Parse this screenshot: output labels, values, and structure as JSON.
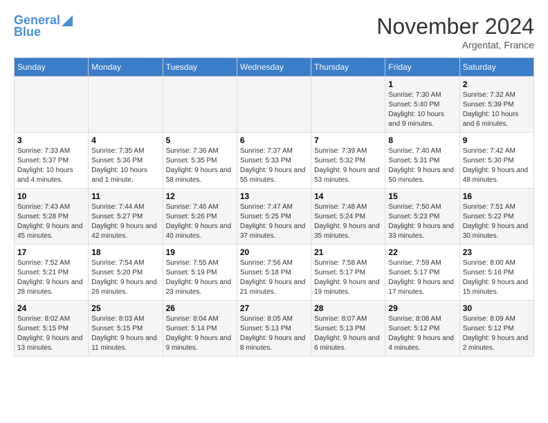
{
  "header": {
    "logo_line1": "General",
    "logo_line2": "Blue",
    "month": "November 2024",
    "location": "Argentat, France"
  },
  "weekdays": [
    "Sunday",
    "Monday",
    "Tuesday",
    "Wednesday",
    "Thursday",
    "Friday",
    "Saturday"
  ],
  "weeks": [
    [
      {
        "day": "",
        "info": ""
      },
      {
        "day": "",
        "info": ""
      },
      {
        "day": "",
        "info": ""
      },
      {
        "day": "",
        "info": ""
      },
      {
        "day": "",
        "info": ""
      },
      {
        "day": "1",
        "info": "Sunrise: 7:30 AM\nSunset: 5:40 PM\nDaylight: 10 hours and 9 minutes."
      },
      {
        "day": "2",
        "info": "Sunrise: 7:32 AM\nSunset: 5:39 PM\nDaylight: 10 hours and 6 minutes."
      }
    ],
    [
      {
        "day": "3",
        "info": "Sunrise: 7:33 AM\nSunset: 5:37 PM\nDaylight: 10 hours and 4 minutes."
      },
      {
        "day": "4",
        "info": "Sunrise: 7:35 AM\nSunset: 5:36 PM\nDaylight: 10 hours and 1 minute."
      },
      {
        "day": "5",
        "info": "Sunrise: 7:36 AM\nSunset: 5:35 PM\nDaylight: 9 hours and 58 minutes."
      },
      {
        "day": "6",
        "info": "Sunrise: 7:37 AM\nSunset: 5:33 PM\nDaylight: 9 hours and 55 minutes."
      },
      {
        "day": "7",
        "info": "Sunrise: 7:39 AM\nSunset: 5:32 PM\nDaylight: 9 hours and 53 minutes."
      },
      {
        "day": "8",
        "info": "Sunrise: 7:40 AM\nSunset: 5:31 PM\nDaylight: 9 hours and 50 minutes."
      },
      {
        "day": "9",
        "info": "Sunrise: 7:42 AM\nSunset: 5:30 PM\nDaylight: 9 hours and 48 minutes."
      }
    ],
    [
      {
        "day": "10",
        "info": "Sunrise: 7:43 AM\nSunset: 5:28 PM\nDaylight: 9 hours and 45 minutes."
      },
      {
        "day": "11",
        "info": "Sunrise: 7:44 AM\nSunset: 5:27 PM\nDaylight: 9 hours and 42 minutes."
      },
      {
        "day": "12",
        "info": "Sunrise: 7:46 AM\nSunset: 5:26 PM\nDaylight: 9 hours and 40 minutes."
      },
      {
        "day": "13",
        "info": "Sunrise: 7:47 AM\nSunset: 5:25 PM\nDaylight: 9 hours and 37 minutes."
      },
      {
        "day": "14",
        "info": "Sunrise: 7:48 AM\nSunset: 5:24 PM\nDaylight: 9 hours and 35 minutes."
      },
      {
        "day": "15",
        "info": "Sunrise: 7:50 AM\nSunset: 5:23 PM\nDaylight: 9 hours and 33 minutes."
      },
      {
        "day": "16",
        "info": "Sunrise: 7:51 AM\nSunset: 5:22 PM\nDaylight: 9 hours and 30 minutes."
      }
    ],
    [
      {
        "day": "17",
        "info": "Sunrise: 7:52 AM\nSunset: 5:21 PM\nDaylight: 9 hours and 28 minutes."
      },
      {
        "day": "18",
        "info": "Sunrise: 7:54 AM\nSunset: 5:20 PM\nDaylight: 9 hours and 26 minutes."
      },
      {
        "day": "19",
        "info": "Sunrise: 7:55 AM\nSunset: 5:19 PM\nDaylight: 9 hours and 23 minutes."
      },
      {
        "day": "20",
        "info": "Sunrise: 7:56 AM\nSunset: 5:18 PM\nDaylight: 9 hours and 21 minutes."
      },
      {
        "day": "21",
        "info": "Sunrise: 7:58 AM\nSunset: 5:17 PM\nDaylight: 9 hours and 19 minutes."
      },
      {
        "day": "22",
        "info": "Sunrise: 7:59 AM\nSunset: 5:17 PM\nDaylight: 9 hours and 17 minutes."
      },
      {
        "day": "23",
        "info": "Sunrise: 8:00 AM\nSunset: 5:16 PM\nDaylight: 9 hours and 15 minutes."
      }
    ],
    [
      {
        "day": "24",
        "info": "Sunrise: 8:02 AM\nSunset: 5:15 PM\nDaylight: 9 hours and 13 minutes."
      },
      {
        "day": "25",
        "info": "Sunrise: 8:03 AM\nSunset: 5:15 PM\nDaylight: 9 hours and 11 minutes."
      },
      {
        "day": "26",
        "info": "Sunrise: 8:04 AM\nSunset: 5:14 PM\nDaylight: 9 hours and 9 minutes."
      },
      {
        "day": "27",
        "info": "Sunrise: 8:05 AM\nSunset: 5:13 PM\nDaylight: 9 hours and 8 minutes."
      },
      {
        "day": "28",
        "info": "Sunrise: 8:07 AM\nSunset: 5:13 PM\nDaylight: 9 hours and 6 minutes."
      },
      {
        "day": "29",
        "info": "Sunrise: 8:08 AM\nSunset: 5:12 PM\nDaylight: 9 hours and 4 minutes."
      },
      {
        "day": "30",
        "info": "Sunrise: 8:09 AM\nSunset: 5:12 PM\nDaylight: 9 hours and 2 minutes."
      }
    ]
  ]
}
